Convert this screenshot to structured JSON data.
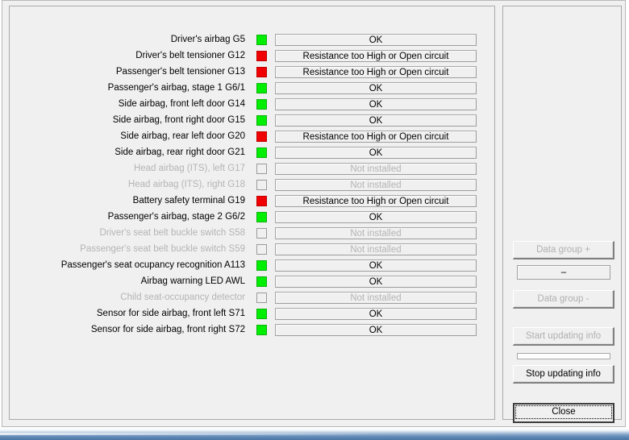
{
  "diagnostic_rows": [
    {
      "label": "Driver's airbag G5",
      "indicator": "green",
      "status": "OK",
      "enabled": true
    },
    {
      "label": "Driver's belt tensioner G12",
      "indicator": "red",
      "status": "Resistance too High or Open circuit",
      "enabled": true
    },
    {
      "label": "Passenger's belt tensioner G13",
      "indicator": "red",
      "status": "Resistance too High or Open circuit",
      "enabled": true
    },
    {
      "label": "Passenger's airbag, stage 1 G6/1",
      "indicator": "green",
      "status": "OK",
      "enabled": true
    },
    {
      "label": "Side airbag, front left door G14",
      "indicator": "green",
      "status": "OK",
      "enabled": true
    },
    {
      "label": "Side airbag, front right door G15",
      "indicator": "green",
      "status": "OK",
      "enabled": true
    },
    {
      "label": "Side airbag, rear left door G20",
      "indicator": "red",
      "status": "Resistance too High or Open circuit",
      "enabled": true
    },
    {
      "label": "Side airbag, rear right door G21",
      "indicator": "green",
      "status": "OK",
      "enabled": true
    },
    {
      "label": "Head airbag (ITS), left G17",
      "indicator": "empty",
      "status": "Not installed",
      "enabled": false
    },
    {
      "label": "Head airbag (ITS), right G18",
      "indicator": "empty",
      "status": "Not installed",
      "enabled": false
    },
    {
      "label": "Battery safety terminal G19",
      "indicator": "red",
      "status": "Resistance too High or Open circuit",
      "enabled": true
    },
    {
      "label": "Passenger's airbag, stage 2 G6/2",
      "indicator": "green",
      "status": "OK",
      "enabled": true
    },
    {
      "label": "Driver's seat belt buckle switch S58",
      "indicator": "empty",
      "status": "Not installed",
      "enabled": false
    },
    {
      "label": "Passenger's seat belt buckle switch S59",
      "indicator": "empty",
      "status": "Not installed",
      "enabled": false
    },
    {
      "label": "Passenger's seat ocupancy recognition A113",
      "indicator": "green",
      "status": "OK",
      "enabled": true
    },
    {
      "label": "Airbag warning LED AWL",
      "indicator": "green",
      "status": "OK",
      "enabled": true
    },
    {
      "label": "Child seat-occupancy detector",
      "indicator": "empty",
      "status": "Not installed",
      "enabled": false
    },
    {
      "label": "Sensor for side airbag, front left S71",
      "indicator": "green",
      "status": "OK",
      "enabled": true
    },
    {
      "label": "Sensor for side airbag, front right S72",
      "indicator": "green",
      "status": "OK",
      "enabled": true
    }
  ],
  "sidebar": {
    "data_group_plus_label": "Data group +",
    "data_group_value": "–",
    "data_group_minus_label": "Data group -",
    "start_updating_label": "Start updating info",
    "stop_updating_label": "Stop updating info",
    "close_label": "Close"
  },
  "colors": {
    "indicator_ok": "#00ee00",
    "indicator_fail": "#f00000",
    "indicator_empty": "#f0f0f0",
    "window_background": "#f0f0f0",
    "disabled_text": "#b4b4b4"
  }
}
